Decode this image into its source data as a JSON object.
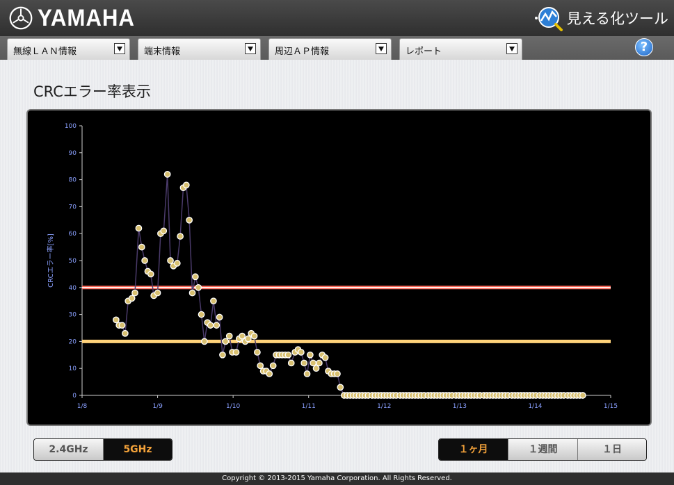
{
  "brand": {
    "name": "YAMAHA",
    "tool_name": "見える化ツール"
  },
  "nav": {
    "menus": [
      {
        "label": "無線ＬＡＮ情報"
      },
      {
        "label": "端末情報"
      },
      {
        "label": "周辺ＡＰ情報"
      },
      {
        "label": "レポート"
      }
    ],
    "help": "?"
  },
  "page": {
    "title": "CRCエラー率表示"
  },
  "band_tabs": [
    {
      "label": "2.4GHz",
      "active": false
    },
    {
      "label": "5GHz",
      "active": true
    }
  ],
  "period_tabs": [
    {
      "label": "１ヶ月",
      "active": true
    },
    {
      "label": "１週間",
      "active": false
    },
    {
      "label": "１日",
      "active": false
    }
  ],
  "footer": {
    "copyright": "Copyright © 2013-2015 Yamaha Corporation. All Rights Reserved."
  },
  "chart_data": {
    "type": "line",
    "ylabel": "CRCエラー率[%]",
    "xlabel": "",
    "ylim": [
      0,
      100
    ],
    "yticks": [
      0,
      10,
      20,
      30,
      40,
      50,
      60,
      70,
      80,
      90,
      100
    ],
    "xticks": [
      {
        "label": "1/8",
        "value": 8
      },
      {
        "label": "1/9",
        "value": 9
      },
      {
        "label": "1/10",
        "value": 10
      },
      {
        "label": "1/11",
        "value": 11
      },
      {
        "label": "1/12",
        "value": 12
      },
      {
        "label": "1/13",
        "value": 13
      },
      {
        "label": "1/14",
        "value": 14
      },
      {
        "label": "1/15",
        "value": 15
      }
    ],
    "xlim": [
      8,
      15
    ],
    "thresholds": [
      {
        "value": 40,
        "color": "#ff6a5a"
      },
      {
        "value": 20,
        "color": "#ffd27a"
      }
    ],
    "colors": {
      "line": "#4a3a6a",
      "point": "#d8c070",
      "point_edge": "#ffffff"
    },
    "series": [
      {
        "points": [
          [
            8.45,
            28
          ],
          [
            8.49,
            26
          ],
          [
            8.53,
            26
          ],
          [
            8.57,
            23
          ],
          [
            8.61,
            35
          ],
          [
            8.66,
            36
          ],
          [
            8.7,
            38
          ],
          [
            8.75,
            62
          ],
          [
            8.79,
            55
          ],
          [
            8.83,
            50
          ],
          [
            8.87,
            46
          ],
          [
            8.91,
            45
          ],
          [
            8.95,
            37
          ],
          [
            9.0,
            38
          ],
          [
            9.04,
            60
          ],
          [
            9.08,
            61
          ],
          [
            9.13,
            82
          ],
          [
            9.17,
            50
          ],
          [
            9.21,
            48
          ],
          [
            9.26,
            49
          ],
          [
            9.3,
            59
          ],
          [
            9.34,
            77
          ],
          [
            9.38,
            78
          ],
          [
            9.42,
            65
          ],
          [
            9.46,
            38
          ],
          [
            9.5,
            44
          ],
          [
            9.54,
            40
          ],
          [
            9.58,
            30
          ],
          [
            9.62,
            20
          ],
          [
            9.66,
            27
          ],
          [
            9.7,
            26
          ],
          [
            9.74,
            35
          ],
          [
            9.78,
            26
          ],
          [
            9.82,
            29
          ],
          [
            9.86,
            15
          ],
          [
            9.9,
            20
          ],
          [
            9.95,
            22
          ],
          [
            9.99,
            16
          ],
          [
            10.04,
            16
          ],
          [
            10.08,
            21
          ],
          [
            10.12,
            22
          ],
          [
            10.16,
            20
          ],
          [
            10.2,
            21
          ],
          [
            10.24,
            23
          ],
          [
            10.28,
            22
          ],
          [
            10.32,
            16
          ],
          [
            10.36,
            11
          ],
          [
            10.4,
            9
          ],
          [
            10.44,
            9
          ],
          [
            10.48,
            8
          ],
          [
            10.53,
            11
          ],
          [
            10.57,
            15
          ],
          [
            10.61,
            15
          ],
          [
            10.65,
            15
          ],
          [
            10.69,
            15
          ],
          [
            10.73,
            15
          ],
          [
            10.77,
            12
          ],
          [
            10.82,
            16
          ],
          [
            10.86,
            17
          ],
          [
            10.9,
            16
          ],
          [
            10.94,
            12
          ],
          [
            10.98,
            8
          ],
          [
            11.02,
            15
          ],
          [
            11.06,
            12
          ],
          [
            11.1,
            10
          ],
          [
            11.14,
            12
          ],
          [
            11.18,
            15
          ],
          [
            11.22,
            14
          ],
          [
            11.26,
            9
          ],
          [
            11.3,
            8
          ],
          [
            11.34,
            8
          ],
          [
            11.38,
            8
          ],
          [
            11.42,
            3
          ],
          [
            11.47,
            0
          ],
          [
            11.51,
            0
          ],
          [
            11.55,
            0
          ],
          [
            11.59,
            0
          ],
          [
            11.63,
            0
          ],
          [
            11.67,
            0
          ],
          [
            11.71,
            0
          ],
          [
            11.75,
            0
          ],
          [
            11.79,
            0
          ],
          [
            11.84,
            0
          ],
          [
            11.88,
            0
          ],
          [
            11.92,
            0
          ],
          [
            11.96,
            0
          ],
          [
            12.0,
            0
          ],
          [
            12.04,
            0
          ],
          [
            12.08,
            0
          ],
          [
            12.12,
            0
          ],
          [
            12.16,
            0
          ],
          [
            12.21,
            0
          ],
          [
            12.25,
            0
          ],
          [
            12.29,
            0
          ],
          [
            12.33,
            0
          ],
          [
            12.37,
            0
          ],
          [
            12.41,
            0
          ],
          [
            12.45,
            0
          ],
          [
            12.49,
            0
          ],
          [
            12.53,
            0
          ],
          [
            12.58,
            0
          ],
          [
            12.62,
            0
          ],
          [
            12.66,
            0
          ],
          [
            12.7,
            0
          ],
          [
            12.74,
            0
          ],
          [
            12.78,
            0
          ],
          [
            12.82,
            0
          ],
          [
            12.86,
            0
          ],
          [
            12.9,
            0
          ],
          [
            12.95,
            0
          ],
          [
            12.99,
            0
          ],
          [
            13.03,
            0
          ],
          [
            13.07,
            0
          ],
          [
            13.11,
            0
          ],
          [
            13.15,
            0
          ],
          [
            13.19,
            0
          ],
          [
            13.23,
            0
          ],
          [
            13.27,
            0
          ],
          [
            13.32,
            0
          ],
          [
            13.36,
            0
          ],
          [
            13.4,
            0
          ],
          [
            13.44,
            0
          ],
          [
            13.48,
            0
          ],
          [
            13.52,
            0
          ],
          [
            13.56,
            0
          ],
          [
            13.6,
            0
          ],
          [
            13.64,
            0
          ],
          [
            13.69,
            0
          ],
          [
            13.73,
            0
          ],
          [
            13.77,
            0
          ],
          [
            13.81,
            0
          ],
          [
            13.85,
            0
          ],
          [
            13.89,
            0
          ],
          [
            13.93,
            0
          ],
          [
            13.97,
            0
          ],
          [
            14.01,
            0
          ],
          [
            14.06,
            0
          ],
          [
            14.1,
            0
          ],
          [
            14.14,
            0
          ],
          [
            14.18,
            0
          ],
          [
            14.22,
            0
          ],
          [
            14.26,
            0
          ],
          [
            14.3,
            0
          ],
          [
            14.34,
            0
          ],
          [
            14.38,
            0
          ],
          [
            14.43,
            0
          ],
          [
            14.47,
            0
          ],
          [
            14.51,
            0
          ],
          [
            14.55,
            0
          ],
          [
            14.59,
            0
          ],
          [
            14.63,
            0
          ]
        ]
      }
    ]
  }
}
